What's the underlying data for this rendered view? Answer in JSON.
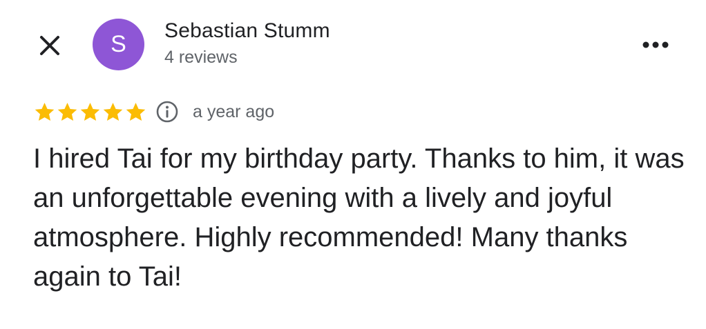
{
  "colors": {
    "avatar_bg": "#8e56d6",
    "star": "#fbbc04",
    "text": "#202124",
    "muted": "#5f6368"
  },
  "header": {
    "close_icon": "close-icon",
    "more_icon": "more-options-icon",
    "avatar_letter": "S",
    "reviewer_name": "Sebastian Stumm",
    "review_count": "4 reviews"
  },
  "review": {
    "rating": 5,
    "rating_max": 5,
    "info_icon": "info-icon",
    "time": "a year ago",
    "text": "I hired Tai for my birthday party. Thanks to him, it was an unforgettable evening with a lively and joyful atmosphere. Highly recommended! Many thanks again to Tai!"
  }
}
